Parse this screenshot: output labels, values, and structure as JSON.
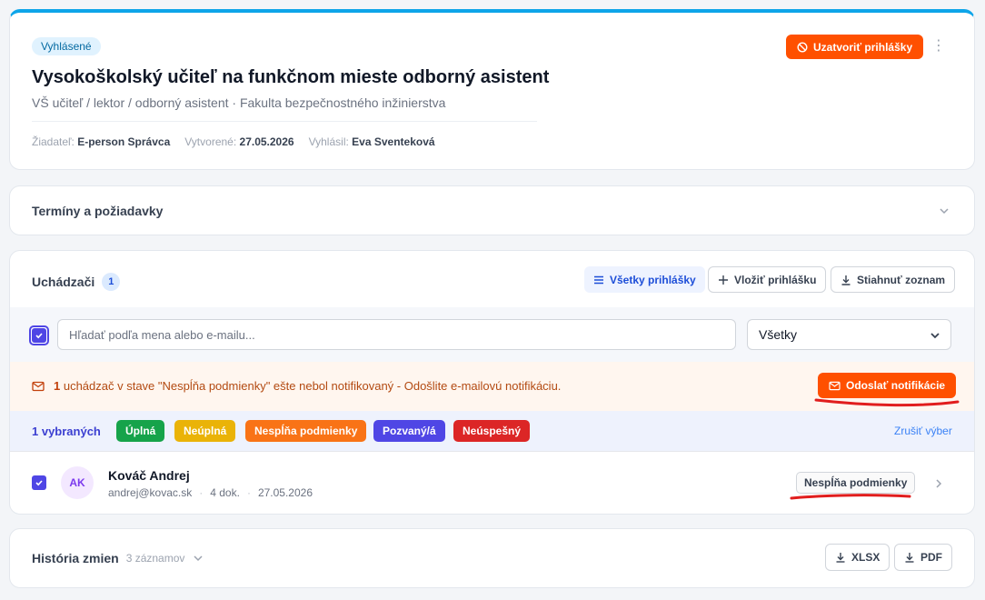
{
  "header": {
    "status": "Vyhlásené",
    "title": "Vysokoškolský učiteľ na funkčnom mieste odborný asistent",
    "subtitle": "VŠ učiteľ / lektor / odborný asistent · Fakulta bezpečnostného inžinierstva",
    "meta": {
      "requester_label": "Žiadateľ:",
      "requester": "E-person Správca",
      "created_label": "Vytvorené:",
      "created": "27.05.2026",
      "published_label": "Vyhlásil:",
      "published_by": "Eva Sventeková"
    },
    "close_button": "Uzatvoriť prihlášky"
  },
  "terms": {
    "title": "Termíny a požiadavky"
  },
  "applicants": {
    "title": "Uchádzači",
    "count": "1",
    "all_apps_button": "Všetky prihlášky",
    "add_app_button": "Vložiť prihlášku",
    "download_button": "Stiahnuť zoznam",
    "search_placeholder": "Hľadať podľa mena alebo e-mailu...",
    "filter_value": "Všetky",
    "notice": {
      "count": "1",
      "text": " uchádzač v stave \"Nespĺňa podmienky\" ešte nebol notifikovaný - Odošlite e-mailovú notifikáciu.",
      "send_button": "Odoslať notifikácie"
    },
    "bulk": {
      "selected": "1 vybraných",
      "statuses": [
        {
          "label": "Úplná",
          "color": "#16a34a"
        },
        {
          "label": "Neúplná",
          "color": "#eab308"
        },
        {
          "label": "Nespĺňa podmienky",
          "color": "#f97316"
        },
        {
          "label": "Pozvaný/á",
          "color": "#4f46e5"
        },
        {
          "label": "Neúspešný",
          "color": "#dc2626"
        }
      ],
      "clear": "Zrušiť výber"
    },
    "rows": [
      {
        "initials": "AK",
        "name": "Kováč Andrej",
        "email": "andrej@kovac.sk",
        "docs": "4 dok.",
        "date": "27.05.2026",
        "status": "Nespĺňa podmienky"
      }
    ]
  },
  "history": {
    "title": "História zmien",
    "count": "3 záznamov",
    "xlsx": "XLSX",
    "pdf": "PDF"
  },
  "colors": {
    "accent_orange": "#ff5000",
    "top_border": "#0ea5e9",
    "primary": "#4f46e5",
    "annotation_red": "#e11d1d"
  }
}
